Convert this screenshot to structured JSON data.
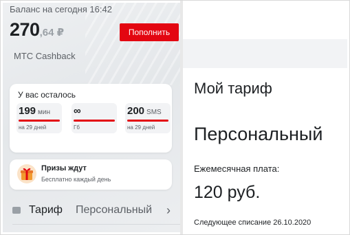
{
  "app": {
    "balance_label": "Баланс на сегодня 16:42",
    "balance_main": "270",
    "balance_cents": ",64 ₽",
    "topup_label": "Пополнить",
    "cashback_label": "МТС Cashback",
    "remaining": {
      "title": "У вас осталось",
      "items": [
        {
          "value": "199",
          "unit": "мин",
          "note": "на 29 дней"
        },
        {
          "value": "∞",
          "unit": "",
          "note": "Гб"
        },
        {
          "value": "200",
          "unit": "SMS",
          "note": "на 29 дней"
        }
      ]
    },
    "prizes": {
      "title": "Призы ждут",
      "subtitle": "Бесплатно каждый день"
    },
    "tariff_row": {
      "label": "Тариф",
      "value": "Персональный",
      "chevron": "›"
    }
  },
  "site": {
    "my_tariff": "Мой тариф",
    "tariff_name": "Персональный",
    "fee_label": "Ежемесячная плата:",
    "fee_value": "120 руб.",
    "next_charge": "Следующее списание 26.10.2020"
  },
  "colors": {
    "accent": "#e30611",
    "text": "#1d2023",
    "muted": "#5c6066",
    "tile_bg": "#f2f3f5"
  },
  "icons": {
    "gift": "gift-box-icon",
    "tariff": "sim-card-icon",
    "chevron": "chevron-right-icon"
  }
}
